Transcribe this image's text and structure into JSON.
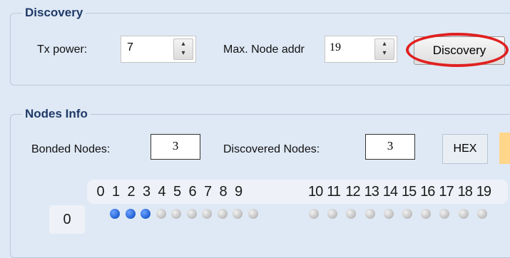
{
  "discovery": {
    "group_title": "Discovery",
    "tx_power_label": "Tx power:",
    "tx_power_value": "7",
    "max_node_label": "Max. Node addr",
    "max_node_value": "19",
    "discovery_button": "Discovery"
  },
  "nodes_info": {
    "group_title": "Nodes Info",
    "bonded_label": "Bonded Nodes:",
    "bonded_value": "3",
    "discovered_label": "Discovered Nodes:",
    "discovered_value": "3",
    "hex_button": "HEX",
    "columns_a": [
      "0",
      "1",
      "2",
      "3",
      "4",
      "5",
      "6",
      "7",
      "8",
      "9"
    ],
    "columns_b": [
      "10",
      "11",
      "12",
      "13",
      "14",
      "15",
      "16",
      "17",
      "18",
      "19"
    ],
    "row_label": "0",
    "row_states": [
      true,
      true,
      true,
      false,
      false,
      false,
      false,
      false,
      false,
      false,
      false,
      false,
      false,
      false,
      false,
      false,
      false,
      false,
      false,
      false
    ]
  },
  "colors": {
    "background": "#dfe9f5",
    "group_title": "#1f3a68",
    "dot_on": "#1f5fd0",
    "dot_off": "#c4c4c4",
    "highlight_oval": "#e02020"
  }
}
